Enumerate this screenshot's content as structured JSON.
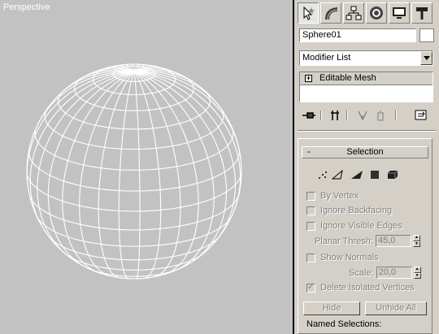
{
  "viewport": {
    "label": "Perspective"
  },
  "command_panel": {
    "tabs": [
      {
        "name": "create-tab",
        "icon": "pointer-star-icon",
        "active": true
      },
      {
        "name": "modify-tab",
        "icon": "bend-icon"
      },
      {
        "name": "hierarchy-tab",
        "icon": "hierarchy-icon"
      },
      {
        "name": "motion-tab",
        "icon": "motion-wheel-icon"
      },
      {
        "name": "display-tab",
        "icon": "monitor-icon"
      },
      {
        "name": "utilities-tab",
        "icon": "hammer-icon"
      }
    ],
    "object_name": "Sphere01",
    "modifier_list": "Modifier List",
    "stack_item": "Editable Mesh"
  },
  "selection_rollout": {
    "toggle": "-",
    "title": "Selection",
    "by_vertex": "By Vertex",
    "ignore_backfacing": "Ignore Backfacing",
    "ignore_visible_edges": "Ignore Visible Edges",
    "planar_thresh_label": "Planar Thresh:",
    "planar_thresh_value": "45,0",
    "show_normals": "Show Normals",
    "scale_label": "Scale:",
    "scale_value": "20,0",
    "delete_isolated": "Delete Isolated Vertices",
    "delete_isolated_checked": true,
    "hide": "Hide",
    "unhide_all": "Unhide All",
    "named_selections": "Named Selections:"
  },
  "colors": {
    "viewport_bg": "#c2c2c2",
    "panel_bg": "#d4d0c8",
    "wireframe": "#ffffff"
  }
}
